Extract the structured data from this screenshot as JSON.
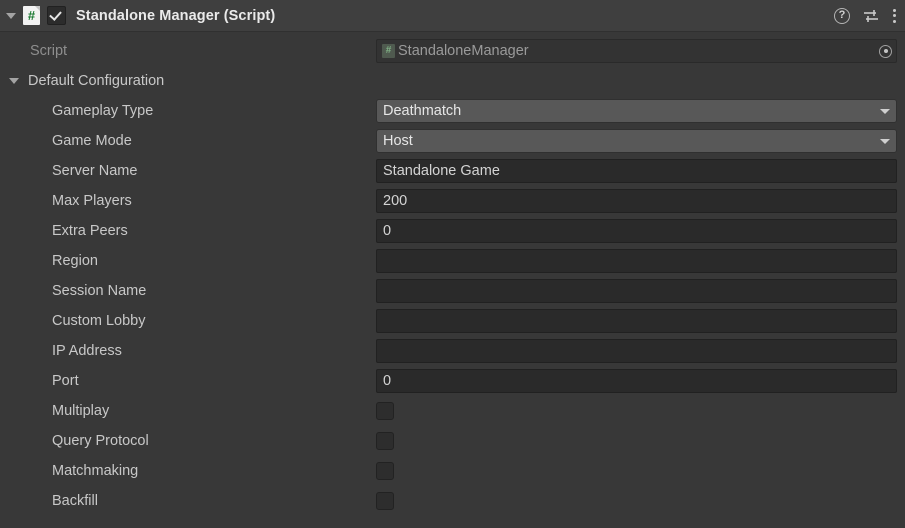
{
  "component": {
    "title": "Standalone Manager (Script)",
    "enabled_checkbox": true,
    "foldout_expanded": true,
    "script_icon": "csharp-script-icon",
    "header_icons": {
      "help": "help-icon",
      "help_glyph": "?",
      "preset": "preset-sliders-icon",
      "menu": "kebab-menu-icon"
    }
  },
  "script_row": {
    "label": "Script",
    "value": "StandaloneManager",
    "icon": "csharp-script-icon",
    "picker": "object-picker-icon"
  },
  "group": {
    "label": "Default Configuration",
    "expanded": true
  },
  "properties": [
    {
      "label": "Gameplay Type",
      "type": "dropdown",
      "value": "Deathmatch"
    },
    {
      "label": "Game Mode",
      "type": "dropdown",
      "value": "Host"
    },
    {
      "label": "Server Name",
      "type": "text",
      "value": "Standalone Game"
    },
    {
      "label": "Max Players",
      "type": "text",
      "value": "200"
    },
    {
      "label": "Extra Peers",
      "type": "text",
      "value": "0"
    },
    {
      "label": "Region",
      "type": "text",
      "value": ""
    },
    {
      "label": "Session Name",
      "type": "text",
      "value": ""
    },
    {
      "label": "Custom Lobby",
      "type": "text",
      "value": ""
    },
    {
      "label": "IP Address",
      "type": "text",
      "value": ""
    },
    {
      "label": "Port",
      "type": "text",
      "value": "0"
    },
    {
      "label": "Multiplay",
      "type": "checkbox",
      "value": false
    },
    {
      "label": "Query Protocol",
      "type": "checkbox",
      "value": false
    },
    {
      "label": "Matchmaking",
      "type": "checkbox",
      "value": false
    },
    {
      "label": "Backfill",
      "type": "checkbox",
      "value": false
    }
  ],
  "colors": {
    "header_bg": "#3f3f3f",
    "body_bg": "#383838",
    "field_bg": "#2a2a2a",
    "dropdown_bg": "#585858",
    "label_text": "#c8c8c8",
    "dim_text": "#8e8e8e",
    "csharp_green": "#1b7a32"
  }
}
